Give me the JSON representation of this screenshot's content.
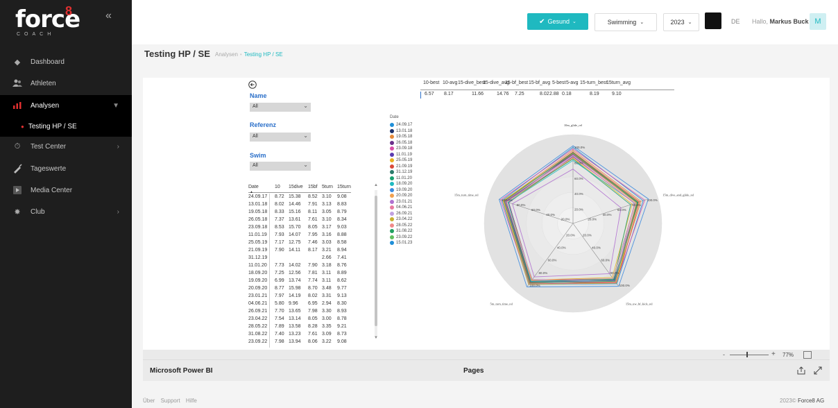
{
  "sidebar": {
    "logo_text": "force",
    "logo_sup": "8",
    "logo_sub": "COACH",
    "collapse_glyph": "«",
    "items": [
      {
        "label": "Dashboard",
        "icon": "diamond-icon"
      },
      {
        "label": "Athleten",
        "icon": "users-icon"
      },
      {
        "label": "Analysen",
        "icon": "bar-chart-icon"
      },
      {
        "label": "Testing HP / SE",
        "icon": "dot-icon"
      },
      {
        "label": "Test Center",
        "icon": "stopwatch-icon"
      },
      {
        "label": "Tageswerte",
        "icon": "syringe-icon"
      },
      {
        "label": "Media Center",
        "icon": "media-icon"
      },
      {
        "label": "Club",
        "icon": "gear-icon"
      }
    ]
  },
  "topbar": {
    "status_label": "Gesund",
    "sport": "Swimming",
    "year": "2023",
    "lang": "DE",
    "hello_prefix": "Hallo,",
    "user_name": "Markus Buck",
    "avatar_initial": "M"
  },
  "page": {
    "title": "Testing HP / SE",
    "breadcrumb_parent": "Analysen",
    "breadcrumb_current": "Testing HP / SE"
  },
  "filters": {
    "name_label": "Name",
    "name_value": "All",
    "referenz_label": "Referenz",
    "referenz_value": "All",
    "swim_label": "Swim",
    "swim_value": "All"
  },
  "table": {
    "headers": [
      "Date",
      "10",
      "15dive",
      "15bf",
      "5turn",
      "15turn"
    ],
    "rows": [
      [
        "24.09.17",
        "8.72",
        "15.38",
        "8.52",
        "3.10",
        "9.08"
      ],
      [
        "13.01.18",
        "8.02",
        "14.46",
        "7.91",
        "3.13",
        "8.83"
      ],
      [
        "19.05.18",
        "8.33",
        "15.16",
        "8.11",
        "3.05",
        "8.79"
      ],
      [
        "26.05.18",
        "7.37",
        "13.61",
        "7.61",
        "3.10",
        "8.34"
      ],
      [
        "23.09.18",
        "8.53",
        "15.70",
        "8.05",
        "3.17",
        "9.03"
      ],
      [
        "11.01.19",
        "7.93",
        "14.07",
        "7.95",
        "3.16",
        "8.88"
      ],
      [
        "25.05.19",
        "7.17",
        "12.75",
        "7.46",
        "3.03",
        "8.58"
      ],
      [
        "21.09.19",
        "7.90",
        "14.11",
        "8.17",
        "3.21",
        "8.94"
      ],
      [
        "31.12.19",
        "",
        "",
        "",
        "2.66",
        "7.41"
      ],
      [
        "11.01.20",
        "7.73",
        "14.02",
        "7.90",
        "3.18",
        "8.76"
      ],
      [
        "18.09.20",
        "7.25",
        "12.56",
        "7.81",
        "3.11",
        "8.89"
      ],
      [
        "19.09.20",
        "6.99",
        "13.74",
        "7.74",
        "3.11",
        "8.62"
      ],
      [
        "20.09.20",
        "8.77",
        "15.98",
        "8.70",
        "3.48",
        "9.77"
      ],
      [
        "23.01.21",
        "7.97",
        "14.19",
        "8.02",
        "3.31",
        "9.13"
      ],
      [
        "04.06.21",
        "5.80",
        "9.96",
        "6.95",
        "2.94",
        "8.30"
      ],
      [
        "26.09.21",
        "7.70",
        "13.65",
        "7.98",
        "3.30",
        "8.93"
      ],
      [
        "23.04.22",
        "7.54",
        "13.14",
        "8.05",
        "3.00",
        "8.78"
      ],
      [
        "28.05.22",
        "7.89",
        "13.58",
        "8.28",
        "3.35",
        "9.21"
      ],
      [
        "31.08.22",
        "7.40",
        "13.23",
        "7.61",
        "3.09",
        "8.73"
      ],
      [
        "23.09.22",
        "7.98",
        "13.94",
        "8.06",
        "3.22",
        "9.08"
      ]
    ]
  },
  "metrics": {
    "headers": [
      "10-best",
      "10-avg",
      "15-dive_best",
      "15-dive_avg",
      "15-bf_best",
      "15-bf_avg",
      "5-best",
      "5-avg",
      "15-turn_best",
      "15turn_avg"
    ],
    "values": [
      "6.57",
      "8.17",
      "11.66",
      "14.76",
      "7.25",
      "8.02",
      "2.88",
      "0.18",
      "8.19",
      "9.10"
    ]
  },
  "legend": {
    "title": "Date",
    "items": [
      {
        "label": "24.09.17",
        "color": "#1f8fd8"
      },
      {
        "label": "13.01.18",
        "color": "#1b2f6b"
      },
      {
        "label": "19.05.18",
        "color": "#e58a3a"
      },
      {
        "label": "26.05.18",
        "color": "#6b2f8a"
      },
      {
        "label": "23.09.18",
        "color": "#d94fa8"
      },
      {
        "label": "11.01.19",
        "color": "#5a3bb0"
      },
      {
        "label": "25.05.19",
        "color": "#e8b020"
      },
      {
        "label": "21.09.19",
        "color": "#d94a3a"
      },
      {
        "label": "31.12.19",
        "color": "#2a7a6a"
      },
      {
        "label": "11.01.20",
        "color": "#1aa070"
      },
      {
        "label": "18.09.20",
        "color": "#1fb9c0"
      },
      {
        "label": "19.09.20",
        "color": "#3a8ae0"
      },
      {
        "label": "20.09.20",
        "color": "#f0a050"
      },
      {
        "label": "23.01.21",
        "color": "#b070d0"
      },
      {
        "label": "04.06.21",
        "color": "#e87aa0"
      },
      {
        "label": "26.09.21",
        "color": "#c0a0e0"
      },
      {
        "label": "23.04.22",
        "color": "#c8b030"
      },
      {
        "label": "28.05.22",
        "color": "#f08a8a"
      },
      {
        "label": "31.08.22",
        "color": "#20a060"
      },
      {
        "label": "23.09.22",
        "color": "#60c060"
      },
      {
        "label": "15.01.23",
        "color": "#1f8fd8"
      }
    ]
  },
  "chart_data": {
    "type": "radar",
    "axes": [
      "10m_glide_rel",
      "15m_dive_and_glide_rel",
      "15m_uw_bf_kick_rel",
      "5m_turn_time_rel",
      "15m_turn_time_rel"
    ],
    "rings": [
      "20.0%",
      "40.0%",
      "60.0%",
      "80.0%",
      "100.0%"
    ],
    "series": [
      {
        "name": "24.09.17",
        "values": [
          0.98,
          0.95,
          0.96,
          0.97,
          0.96
        ]
      },
      {
        "name": "13.01.18",
        "values": [
          0.9,
          0.88,
          0.9,
          0.92,
          0.9
        ]
      },
      {
        "name": "19.05.18",
        "values": [
          0.94,
          0.92,
          0.93,
          0.95,
          0.94
        ]
      },
      {
        "name": "26.05.18",
        "values": [
          0.86,
          0.84,
          0.88,
          0.9,
          0.87
        ]
      },
      {
        "name": "23.09.18",
        "values": [
          0.96,
          0.97,
          0.94,
          0.96,
          0.98
        ]
      },
      {
        "name": "11.01.19",
        "values": [
          0.89,
          0.86,
          0.91,
          0.93,
          0.91
        ]
      },
      {
        "name": "25.05.19",
        "values": [
          0.84,
          0.8,
          0.86,
          0.9,
          0.88
        ]
      },
      {
        "name": "21.09.19",
        "values": [
          0.92,
          0.9,
          0.95,
          0.94,
          0.93
        ]
      },
      {
        "name": "11.01.20",
        "values": [
          0.88,
          0.87,
          0.9,
          0.93,
          0.92
        ]
      },
      {
        "name": "18.09.20",
        "values": [
          0.83,
          0.78,
          0.89,
          0.92,
          0.9
        ]
      },
      {
        "name": "19.09.20",
        "values": [
          0.81,
          0.84,
          0.88,
          0.92,
          0.88
        ]
      },
      {
        "name": "20.09.20",
        "values": [
          1.0,
          1.02,
          1.0,
          1.01,
          1.0
        ]
      },
      {
        "name": "23.01.21",
        "values": [
          0.91,
          0.89,
          0.92,
          0.96,
          0.94
        ]
      },
      {
        "name": "04.06.21",
        "values": [
          0.7,
          0.65,
          0.8,
          0.85,
          0.82
        ]
      },
      {
        "name": "26.09.21",
        "values": [
          0.88,
          0.86,
          0.92,
          0.96,
          0.92
        ]
      },
      {
        "name": "23.04.22",
        "values": [
          0.87,
          0.83,
          0.92,
          0.89,
          0.9
        ]
      },
      {
        "name": "28.05.22",
        "values": [
          0.9,
          0.86,
          0.95,
          0.97,
          0.95
        ]
      },
      {
        "name": "31.08.22",
        "values": [
          0.85,
          0.84,
          0.88,
          0.91,
          0.9
        ]
      },
      {
        "name": "23.09.22",
        "values": [
          0.91,
          0.88,
          0.92,
          0.95,
          0.93
        ]
      }
    ]
  },
  "zoom": {
    "minus": "-",
    "plus": "+",
    "percent": "77%",
    "level": 0.77
  },
  "pbi": {
    "brand": "Microsoft Power BI",
    "pages": "Pages"
  },
  "footer": {
    "links": [
      "Über",
      "Support",
      "Hilfe"
    ],
    "copyright": "2023©",
    "company": "Force8 AG"
  }
}
